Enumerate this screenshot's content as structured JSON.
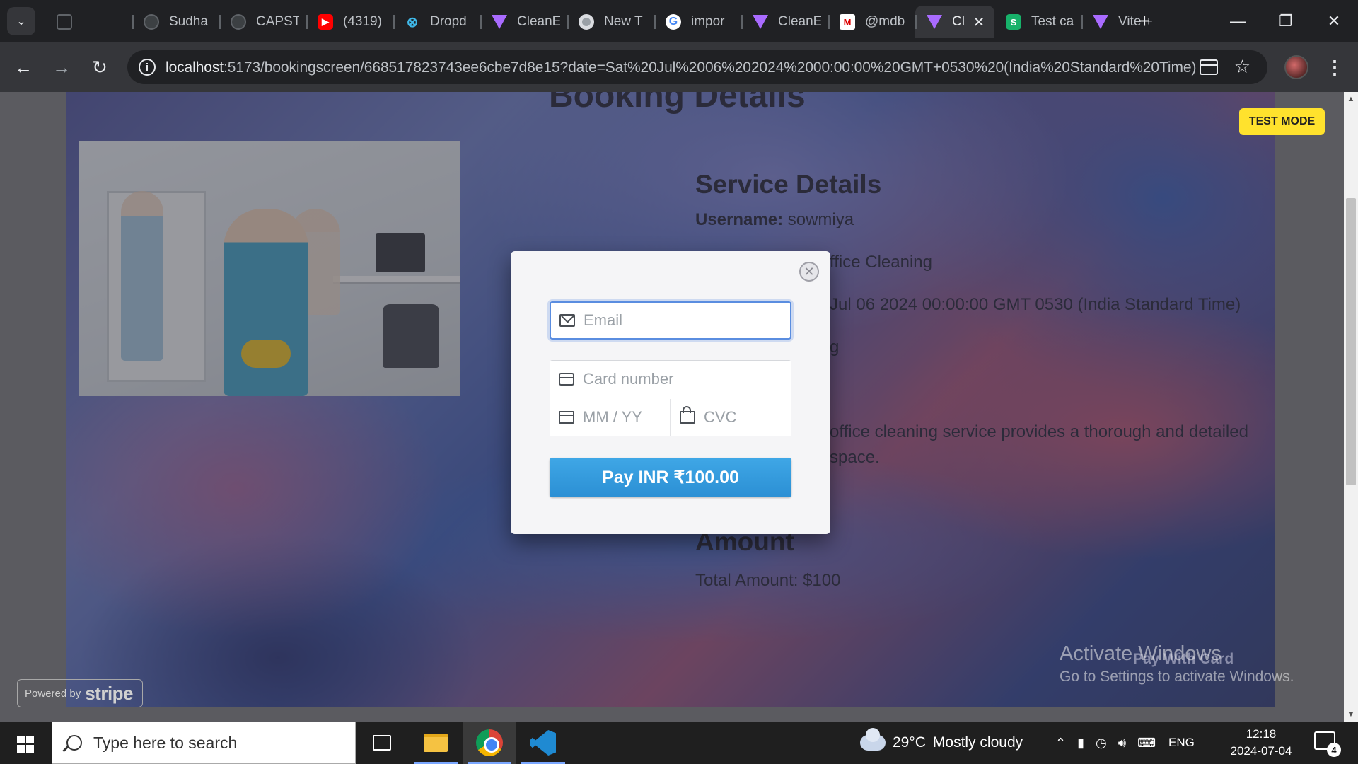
{
  "browser": {
    "tabs": [
      {
        "title": "",
        "favicon": "blank-page-icon",
        "active": false
      },
      {
        "title": "Sudha",
        "favicon": "github-icon",
        "active": false
      },
      {
        "title": "CAPST",
        "favicon": "github-icon",
        "active": false
      },
      {
        "title": "(4319)",
        "favicon": "youtube-icon",
        "active": false
      },
      {
        "title": "Dropd",
        "favicon": "react-bootstrap-icon",
        "active": false
      },
      {
        "title": "CleanE",
        "favicon": "vite-icon",
        "active": false
      },
      {
        "title": "New T",
        "favicon": "chrome-icon",
        "active": false
      },
      {
        "title": "impor",
        "favicon": "google-icon",
        "active": false
      },
      {
        "title": "CleanE",
        "favicon": "vite-icon",
        "active": false
      },
      {
        "title": "@mdb",
        "favicon": "mdb-icon",
        "active": false
      },
      {
        "title": "Cl",
        "favicon": "vite-icon",
        "active": true
      },
      {
        "title": "Test ca",
        "favicon": "stripe-s-icon",
        "active": false
      },
      {
        "title": "Vite +",
        "favicon": "vite-icon",
        "active": false
      }
    ],
    "new_tab_label": "+",
    "url_host": "localhost",
    "url_path": ":5173/bookingscreen/668517823743ee6cbe7d8e15?date=Sat%20Jul%2006%202024%2000:00:00%20GMT+0530%20(India%20Standard%20Time)",
    "window_controls": {
      "minimize": "—",
      "restore": "❐",
      "close": "✕"
    },
    "nav": {
      "back": "←",
      "forward": "→",
      "reload": "↻"
    }
  },
  "page": {
    "heading": "Booking Details",
    "test_mode_label": "TEST MODE",
    "service_details_heading": "Service Details",
    "username_label": "Username:",
    "username_value": "sowmiya",
    "service_line": "ffice Cleaning",
    "date_line": "Jul 06 2024 00:00:00 GMT 0530 (India Standard Time)",
    "type_line": "g",
    "description_line1": "office cleaning service provides a thorough and detailed",
    "description_line2": "space.",
    "amount_heading": "Amount",
    "total_amount": "Total Amount: $100",
    "pay_with_card": "Pay With Card",
    "stripe_powered_by": "Powered by",
    "stripe_brand": "stripe"
  },
  "checkout": {
    "email_placeholder": "Email",
    "card_number_placeholder": "Card number",
    "expiry_placeholder": "MM / YY",
    "cvc_placeholder": "CVC",
    "pay_button": "Pay INR ₹100.00",
    "close_symbol": "✕"
  },
  "windows": {
    "activate_title": "Activate Windows",
    "activate_subtitle": "Go to Settings to activate Windows."
  },
  "taskbar": {
    "search_placeholder": "Type here to search",
    "weather_temp": "29°C",
    "weather_desc": "Mostly cloudy",
    "language": "ENG",
    "time": "12:18",
    "date": "2024-07-04",
    "notification_count": "4"
  }
}
